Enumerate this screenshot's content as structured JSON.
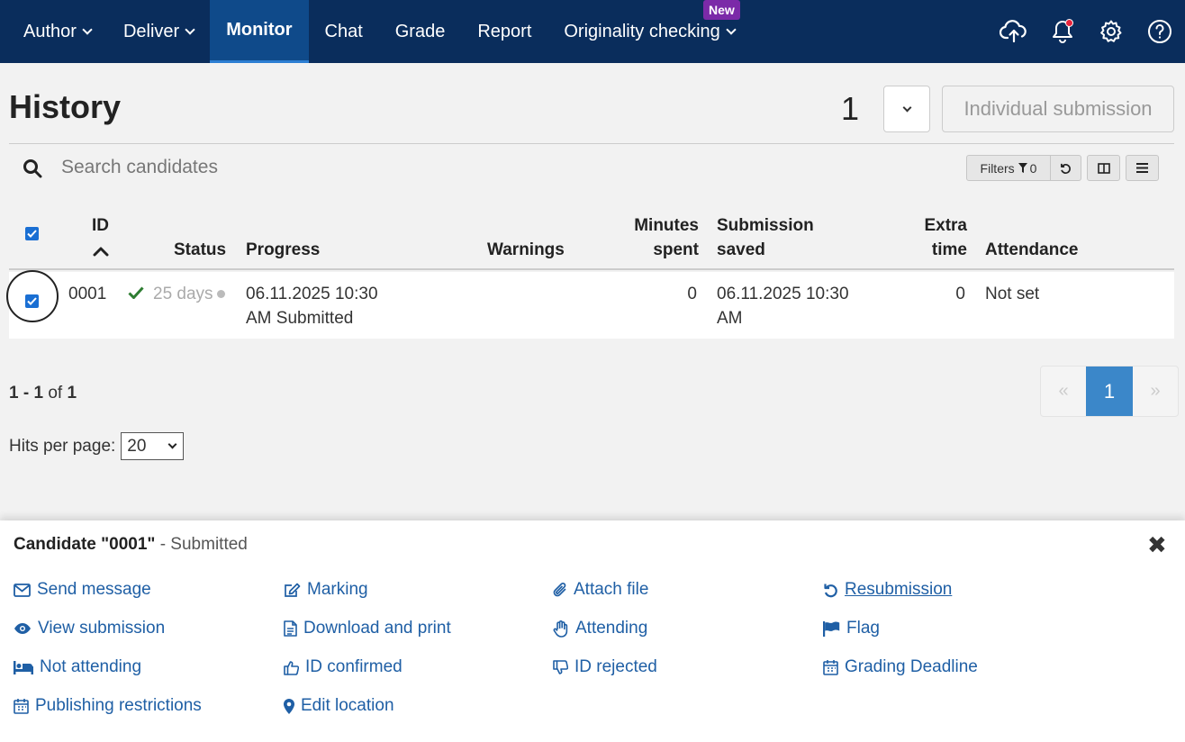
{
  "nav": {
    "items": [
      {
        "label": "Author",
        "dropdown": true
      },
      {
        "label": "Deliver",
        "dropdown": true
      },
      {
        "label": "Monitor",
        "active": true
      },
      {
        "label": "Chat"
      },
      {
        "label": "Grade"
      },
      {
        "label": "Report"
      },
      {
        "label": "Originality checking",
        "dropdown": true,
        "badge": "New"
      }
    ],
    "icons": [
      "upload-cloud-icon",
      "bell-icon",
      "gear-icon",
      "help-icon"
    ]
  },
  "header": {
    "title": "History",
    "count": "1",
    "individual_button": "Individual submission"
  },
  "search": {
    "placeholder": "Search candidates"
  },
  "toolbar": {
    "filters_label": "Filters",
    "filters_count": "0"
  },
  "table": {
    "headers": {
      "id": "ID",
      "status": "Status",
      "progress": "Progress",
      "warnings": "Warnings",
      "minutes_l1": "Minutes",
      "minutes_l2": "spent",
      "submission_l1": "Submission",
      "submission_l2": "saved",
      "extra_l1": "Extra",
      "extra_l2": "time",
      "attendance": "Attendance"
    },
    "rows": [
      {
        "id": "0001",
        "status_days": "25 days",
        "progress_l1": "06.11.2025 10:30",
        "progress_l2": "AM Submitted",
        "warnings": "",
        "minutes": "0",
        "saved_l1": "06.11.2025 10:30",
        "saved_l2": "AM",
        "extra": "0",
        "attendance": "Not set"
      }
    ]
  },
  "pagination": {
    "range_start": "1",
    "range_sep": " - ",
    "range_end": "1",
    "of": " of ",
    "total": "1",
    "prev": "«",
    "current": "1",
    "next": "»",
    "hits_label": "Hits per page:",
    "hits_value": "20"
  },
  "panel": {
    "candidate": "Candidate \"0001\"",
    "status": " - Submitted",
    "close": "✖",
    "actions": {
      "send_message": "Send message",
      "marking": "Marking",
      "attach_file": "Attach file",
      "resubmission": "Resubmission",
      "view_submission": "View submission",
      "download_print": "Download and print",
      "attending": "Attending",
      "flag": "Flag",
      "not_attending": "Not attending",
      "id_confirmed": "ID confirmed",
      "id_rejected": "ID rejected",
      "grading_deadline": "Grading Deadline",
      "publishing_restrictions": "Publishing restrictions",
      "edit_location": "Edit location"
    }
  },
  "colors": {
    "nav_bg": "#0a2d5c",
    "nav_active": "#0f4a8a",
    "badge": "#7b2aa8",
    "link": "#1f5fa5",
    "pager_active": "#3b87c9",
    "check_green": "#2e7d32",
    "notification": "#e8223a"
  }
}
